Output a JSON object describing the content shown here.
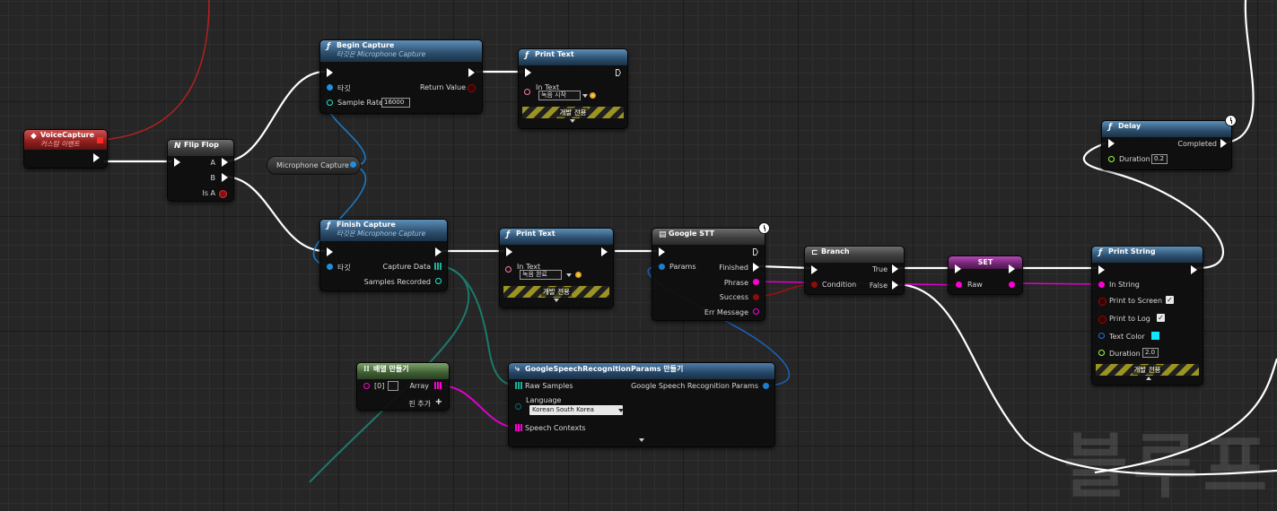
{
  "watermark": "블루프린",
  "voice_capture": {
    "title": "VoiceCapture",
    "subtitle": "커스텀 이벤트"
  },
  "flip_flop": {
    "title": "Flip Flop",
    "pin_a": "A",
    "pin_b": "B",
    "pin_is_a": "Is A"
  },
  "begin_capture": {
    "title": "Begin Capture",
    "subtitle": "타깃은 Microphone Capture",
    "target": "타깃",
    "return_value": "Return Value",
    "sample_rate_label": "Sample Rate",
    "sample_rate_value": "16000"
  },
  "microphone_capture": {
    "label": "Microphone Capture"
  },
  "finish_capture": {
    "title": "Finish Capture",
    "subtitle": "타깃은 Microphone Capture",
    "target": "타깃",
    "capture_data": "Capture Data",
    "samples_recorded": "Samples Recorded"
  },
  "print_text_1": {
    "title": "Print Text",
    "in_text": "In Text",
    "value": "녹음 시작",
    "dev_only": "개발 전용"
  },
  "print_text_2": {
    "title": "Print Text",
    "in_text": "In Text",
    "value": "녹음 완료",
    "dev_only": "개발 전용"
  },
  "google_stt": {
    "title": "Google STT",
    "params": "Params",
    "finished": "Finished",
    "phrase": "Phrase",
    "success": "Success",
    "err_message": "Err Message"
  },
  "branch": {
    "title": "Branch",
    "condition": "Condition",
    "true_label": "True",
    "false_label": "False"
  },
  "set_node": {
    "title": "SET",
    "raw": "Raw"
  },
  "delay": {
    "title": "Delay",
    "completed": "Completed",
    "duration_label": "Duration",
    "duration_value": "0.2"
  },
  "print_string": {
    "title": "Print String",
    "in_string": "In String",
    "print_to_screen": "Print to Screen",
    "print_to_log": "Print to Log",
    "text_color": "Text Color",
    "duration_label": "Duration",
    "duration_value": "2.0",
    "dev_only": "개발 전용"
  },
  "make_array": {
    "title": "배열 만들기",
    "index0": "[0]",
    "array": "Array",
    "add_pin": "핀 추가"
  },
  "make_params": {
    "title": "GoogleSpeechRecognitionParams 만들기",
    "raw_samples": "Raw Samples",
    "output": "Google Speech Recognition Params",
    "language_label": "Language",
    "language_value": "Korean South Korea",
    "speech_contexts": "Speech Contexts"
  },
  "colors": {
    "exec": "#ffffff",
    "object": "#1f8fe0",
    "bool": "#8e0c0c",
    "string": "#ff00d4",
    "float": "#9fff44",
    "struct": "#1b7fd0",
    "text_color_swatch": "#11e6ff"
  }
}
